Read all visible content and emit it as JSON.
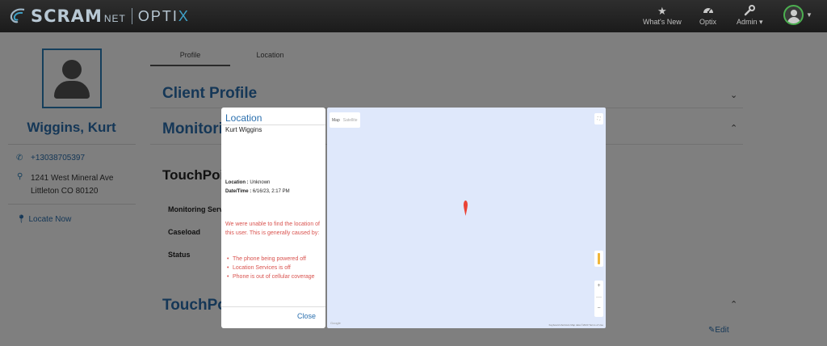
{
  "brand": {
    "name_main": "SCRAM",
    "name_suffix": "NET",
    "product_pre": "OPTI",
    "product_x": "X"
  },
  "nav": {
    "items": [
      {
        "label": "What's New",
        "icon": "star-icon"
      },
      {
        "label": "Optix",
        "icon": "dashboard-icon"
      },
      {
        "label": "Admin",
        "icon": "wrench-icon"
      }
    ]
  },
  "client": {
    "name": "Wiggins, Kurt",
    "phone": "+13038705397",
    "address_line1": "1241 West Mineral Ave",
    "address_line2": "Littleton CO 80120",
    "locate_label": "Locate Now"
  },
  "tabs": [
    {
      "label": "Profile",
      "active": true
    },
    {
      "label": "Location",
      "active": false
    }
  ],
  "main": {
    "client_profile": "Client Profile",
    "monitoring": "Monitori",
    "touchpoint": "TouchPoi",
    "touchpoint2": "TouchPo",
    "fields": [
      "Monitoring Servi",
      "Caseload",
      "Status"
    ],
    "edit_label": "Edit"
  },
  "modal": {
    "title": "Location",
    "client_name": "Kurt Wiggins",
    "location_label": "Location :",
    "location_value": "Unknown",
    "datetime_label": "Date/Time :",
    "datetime_value": "6/16/23, 2:17 PM",
    "error_text": "We were unable to find the location of this user. This is generally caused by:",
    "reasons": [
      "The phone being powered off",
      "Location Services is off",
      "Phone is out of cellular coverage"
    ],
    "close_label": "Close"
  },
  "map": {
    "type_map": "Map",
    "type_satellite": "Satellite",
    "attribution": "Keyboard shortcuts  Map data ©2023  Terms of Use",
    "google_label": "Google",
    "zoom_in": "+",
    "zoom_out": "−"
  },
  "colors": {
    "accent": "#2a6fae",
    "error": "#d9534f",
    "nav_bg": "#222222",
    "map_water": "#dfe8fb",
    "marker": "#ea4335"
  }
}
